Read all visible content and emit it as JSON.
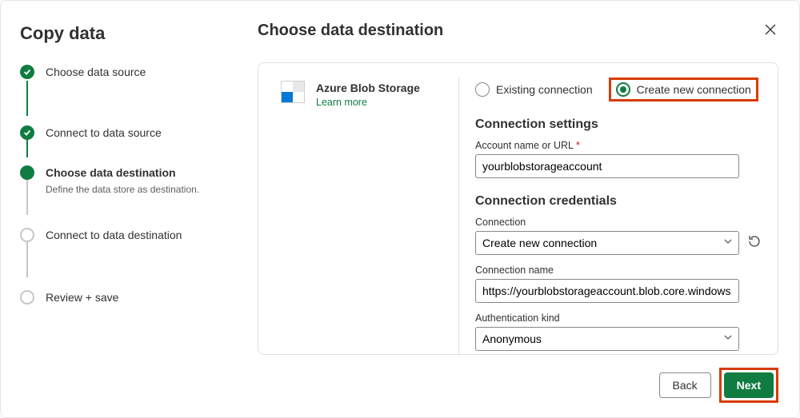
{
  "sidebar": {
    "title": "Copy data",
    "steps": [
      {
        "label": "Choose data source",
        "state": "done"
      },
      {
        "label": "Connect to data source",
        "state": "done"
      },
      {
        "label": "Choose data destination",
        "state": "active",
        "desc": "Define the data store as destination."
      },
      {
        "label": "Connect to data destination",
        "state": "pending"
      },
      {
        "label": "Review + save",
        "state": "pending"
      }
    ]
  },
  "main": {
    "title": "Choose data destination",
    "service": {
      "name": "Azure Blob Storage",
      "learn_more": "Learn more"
    },
    "connection_mode": {
      "existing_label": "Existing connection",
      "create_label": "Create new connection",
      "selected": "create"
    },
    "settings": {
      "heading": "Connection settings",
      "account_label": "Account name or URL",
      "account_value": "yourblobstorageaccount"
    },
    "credentials": {
      "heading": "Connection credentials",
      "connection_label": "Connection",
      "connection_value": "Create new connection",
      "name_label": "Connection name",
      "name_value": "https://yourblobstorageaccount.blob.core.windows.net/",
      "auth_label": "Authentication kind",
      "auth_value": "Anonymous"
    }
  },
  "footer": {
    "back": "Back",
    "next": "Next"
  }
}
